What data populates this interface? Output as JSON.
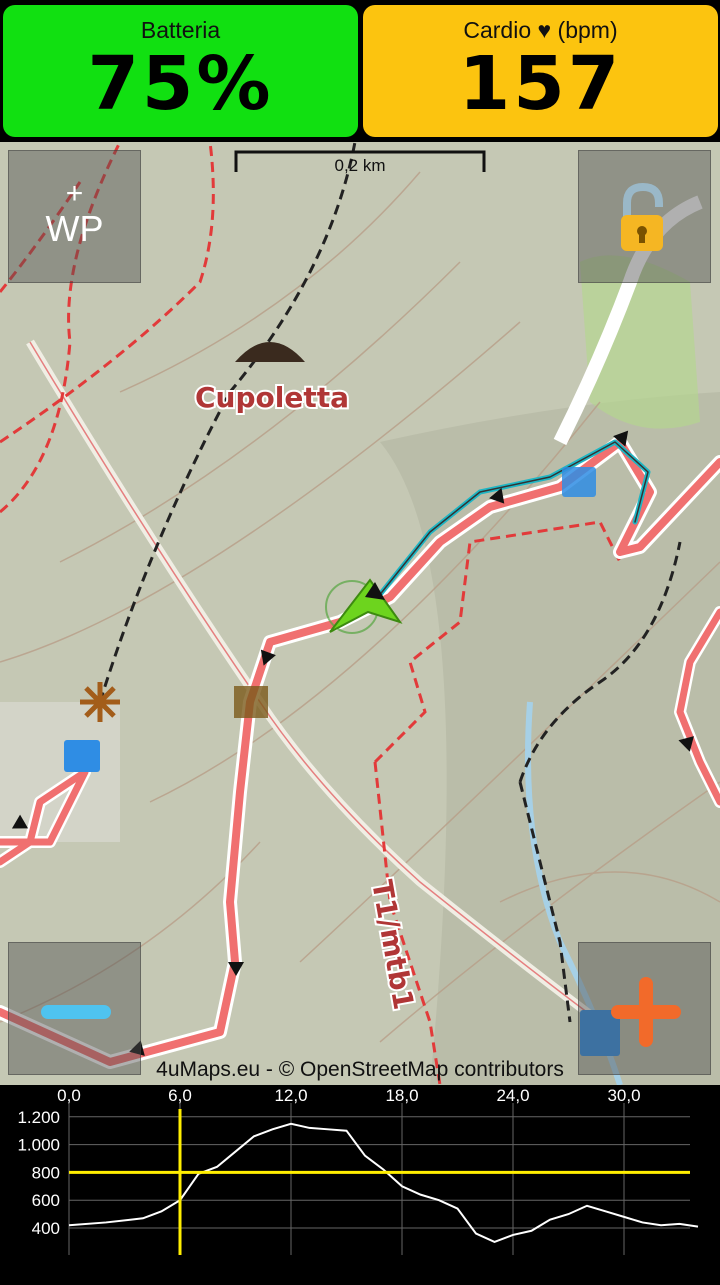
{
  "battery": {
    "label": "Batteria",
    "value": "75%"
  },
  "heart_rate": {
    "label": "Cardio ♥ (bpm)",
    "value": "157"
  },
  "map": {
    "wp_button": {
      "plus": "+",
      "label": "WP"
    },
    "scale": "0,2 km",
    "place_label": "Cupoletta",
    "trail_label": "T1/mtb1",
    "attribution": "4uMaps.eu - © OpenStreetMap contributors",
    "lock_icon": "lock-icon",
    "zoom_out_icon": "minus-icon",
    "zoom_in_icon": "plus-icon",
    "route_color": "#e53935",
    "track_color": "#1fb6c4",
    "position_color": "#6dd41e"
  },
  "elevation_profile": {
    "x_ticks": [
      "0,0",
      "6,0",
      "12,0",
      "18,0",
      "24,0",
      "30,0"
    ],
    "y_ticks": [
      "1.200",
      "1.000",
      "800",
      "600",
      "400"
    ],
    "cursor_x": 6.0,
    "cursor_y": 800,
    "line_color": "#ffffff",
    "cursor_color": "#ffee00"
  }
}
